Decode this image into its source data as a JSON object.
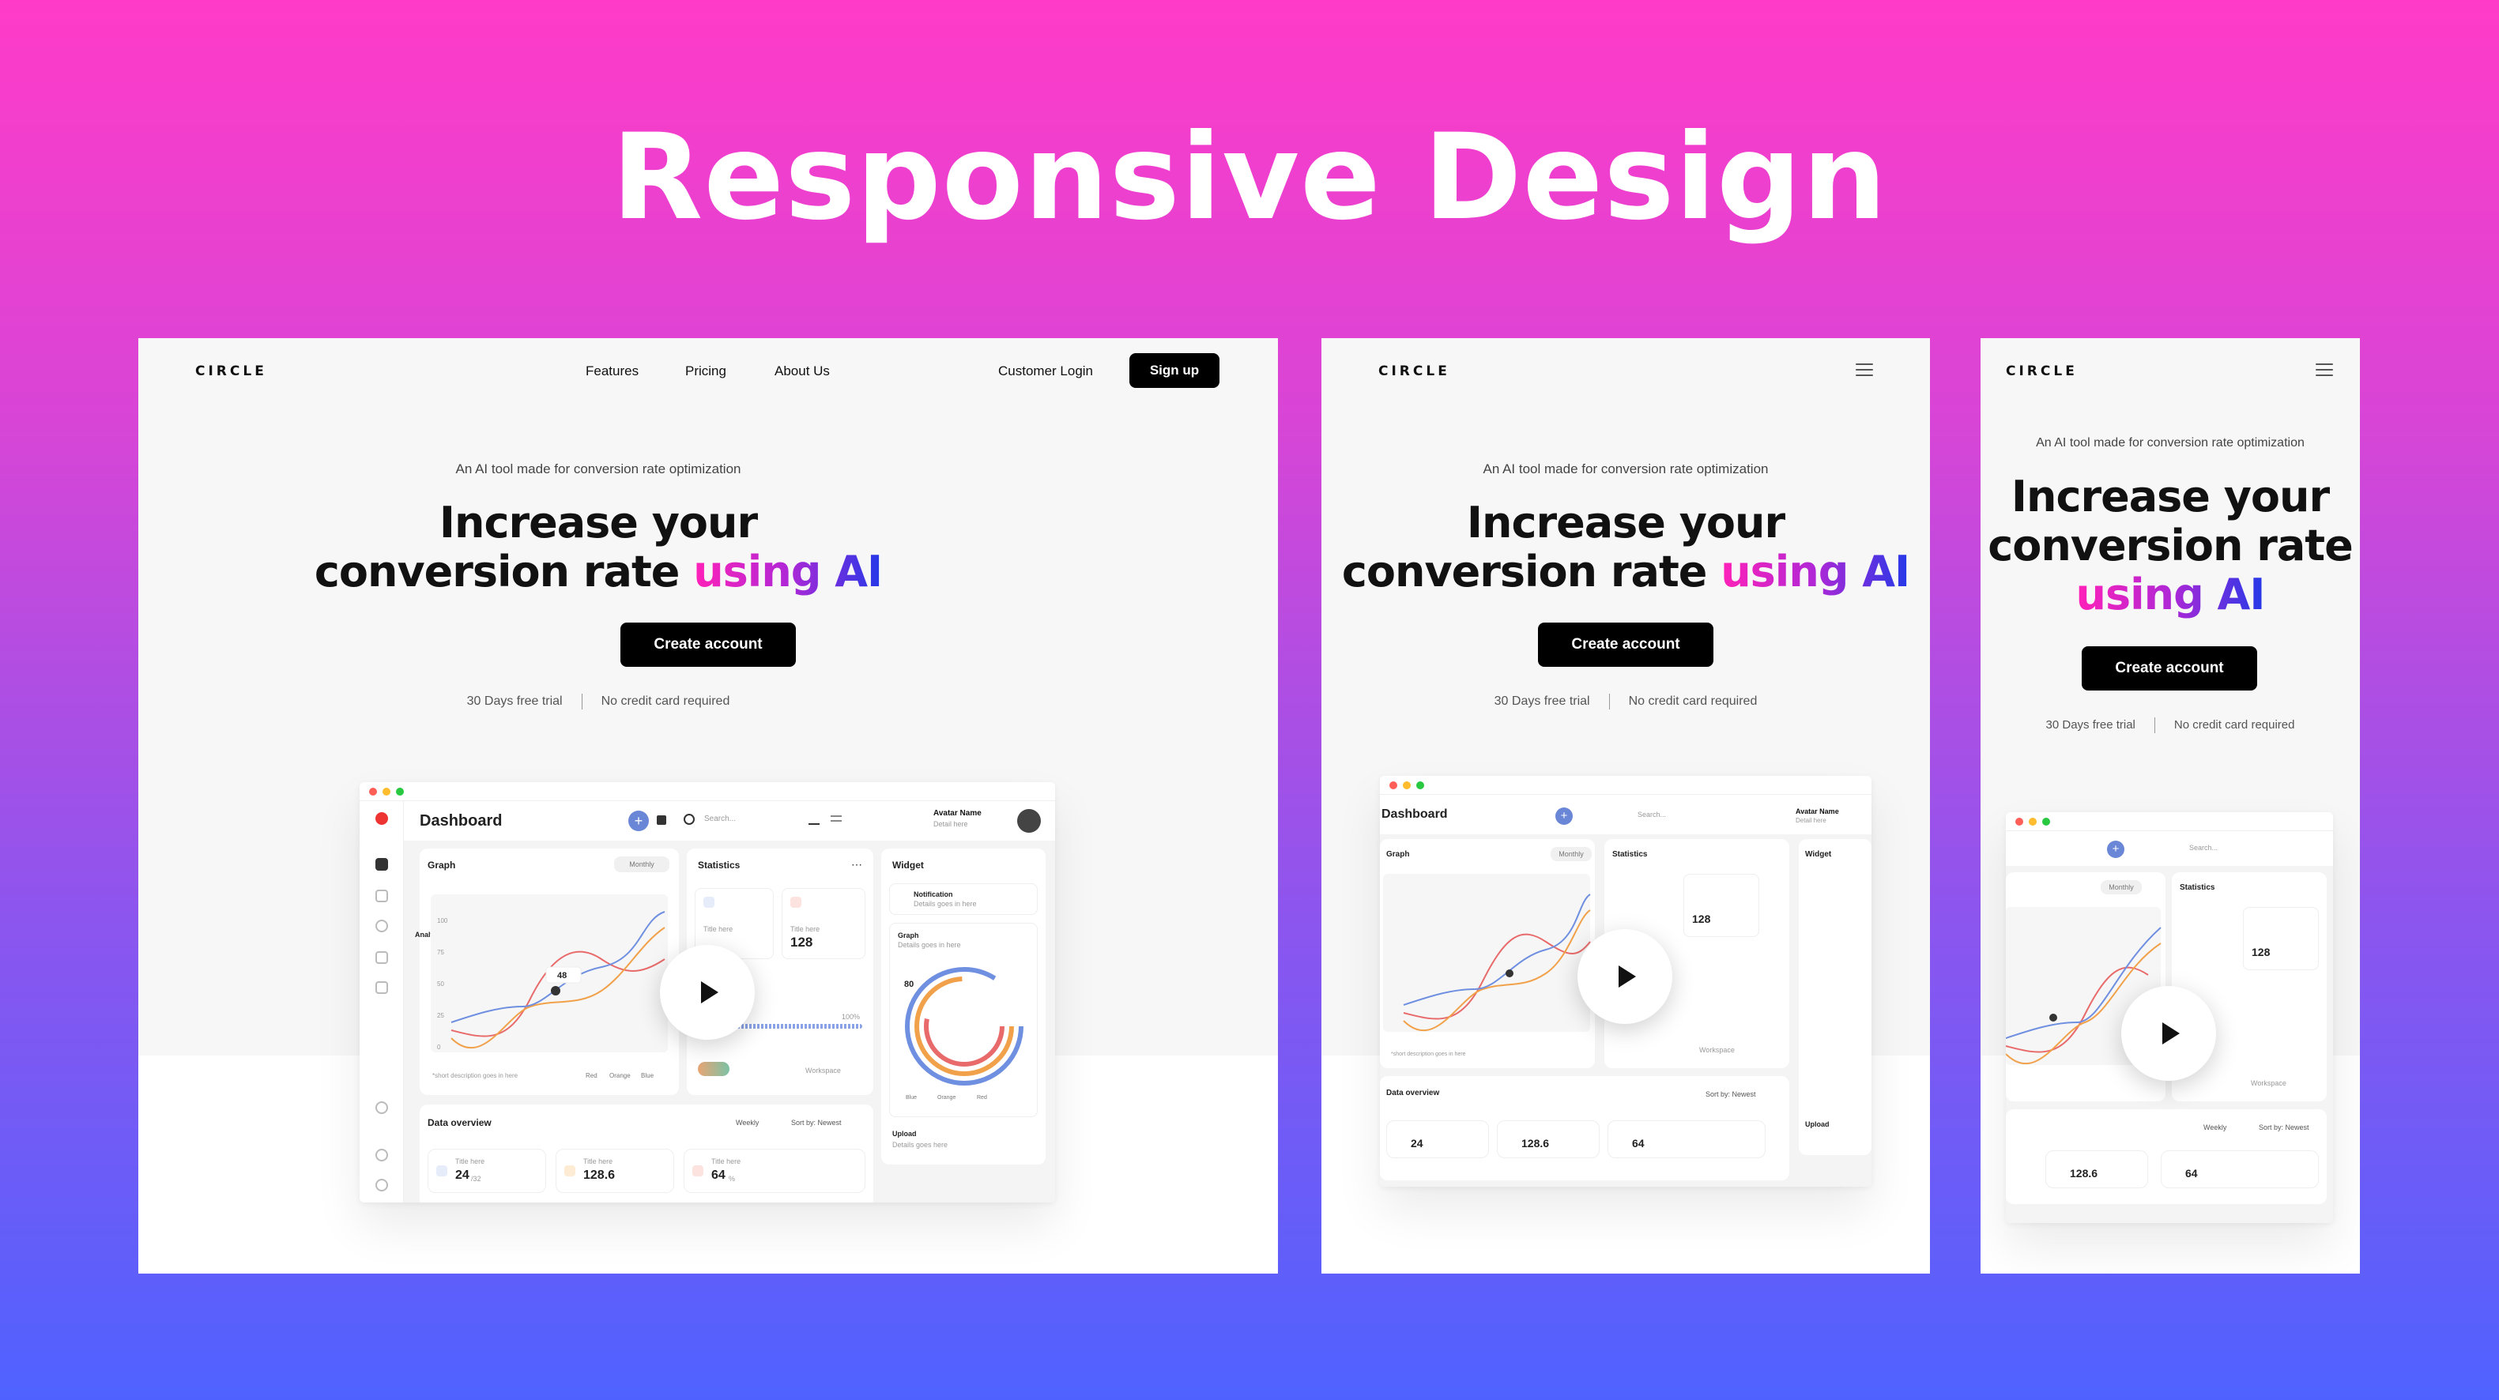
{
  "page_title": "Responsive Design",
  "brand": "CIRCLE",
  "nav": {
    "links": [
      "Features",
      "Pricing",
      "About Us"
    ],
    "login": "Customer Login",
    "signup": "Sign up"
  },
  "hero": {
    "tagline": "An AI tool made for conversion rate optimization",
    "headline_1": "Increase your",
    "headline_2_plain": "conversion rate",
    "headline_2_accent": "using AI",
    "headline_2_full": "conversion rate",
    "headline_3_accent": "using AI",
    "cta": "Create account",
    "trial": "30 Days free trial",
    "no_card": "No credit card required"
  },
  "dashboard": {
    "title": "Dashboard",
    "search_placeholder": "Search...",
    "avatar_name": "Avatar Name",
    "avatar_detail": "Detail here",
    "graph_label": "Graph",
    "period": "Monthly",
    "analytics": "Analytics",
    "y_ticks": [
      "100",
      "75",
      "50",
      "25",
      "0"
    ],
    "point_value": "48",
    "legend": [
      "Red",
      "Orange",
      "Blue"
    ],
    "footnote": "*short description goes in here",
    "statistics": "Statistics",
    "stat_label": "Title here",
    "stat_value": "128",
    "progress": "100%",
    "workspace": "Workspace",
    "widget": "Widget",
    "notification": "Notification",
    "notification_detail": "Details goes in here",
    "widget_graph": "Graph",
    "widget_graph_detail": "Details goes in here",
    "ring_value": "80",
    "ring_legend": [
      "Blue",
      "Orange",
      "Red"
    ],
    "upload": "Upload",
    "upload_detail": "Details goes here",
    "data_overview": "Data overview",
    "weekly": "Weekly",
    "sort": "Sort by: Newest",
    "data_items": [
      {
        "label": "Title here",
        "value": "24",
        "sub": "/32"
      },
      {
        "label": "Title here",
        "value": "128.6",
        "sub": ""
      },
      {
        "label": "Title here",
        "value": "64",
        "sub": "%"
      }
    ]
  },
  "colors": {
    "accent_pink": "#ff22b8",
    "accent_blue": "#2439e8",
    "primary_button": "#000000",
    "chart_red": "#e86a6a",
    "chart_orange": "#f1a14a",
    "chart_blue": "#6f8fe0"
  }
}
